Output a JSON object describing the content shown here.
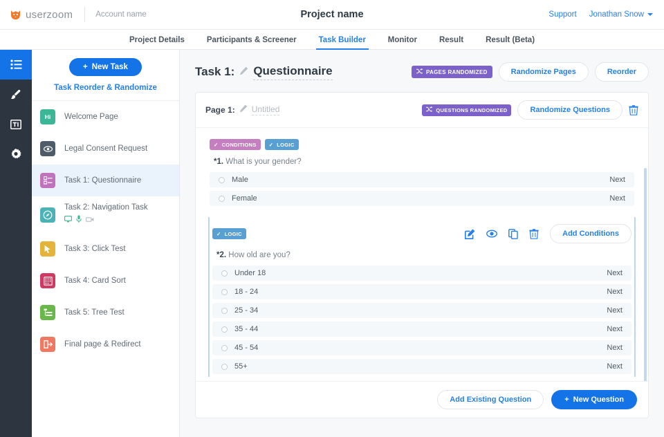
{
  "topbar": {
    "brand": "userzoom",
    "brand_icon": "fox-logo-icon",
    "account_name": "Account name",
    "project_title": "Project name",
    "support_label": "Support",
    "user_name": "Jonathan Snow"
  },
  "nav_tabs": [
    {
      "label": "Project Details",
      "active": false
    },
    {
      "label": "Participants & Screener",
      "active": false
    },
    {
      "label": "Task Builder",
      "active": true
    },
    {
      "label": "Monitor",
      "active": false
    },
    {
      "label": "Result",
      "active": false
    },
    {
      "label": "Result (Beta)",
      "active": false
    }
  ],
  "rail": [
    {
      "icon": "list-icon",
      "active": true
    },
    {
      "icon": "brush-icon",
      "active": false
    },
    {
      "icon": "text-box-icon",
      "active": false
    },
    {
      "icon": "gear-icon",
      "active": false
    }
  ],
  "sidebar": {
    "new_task_label": "New Task",
    "new_task_plus": "+",
    "reorder_link": "Task Reorder & Randomize",
    "items": [
      {
        "label": "Welcome Page",
        "tile_text": "Hi",
        "tile_color": "#3cb795",
        "icon": "hi-tile-icon",
        "selected": false,
        "subicons": []
      },
      {
        "label": "Legal Consent Request",
        "tile_text": "",
        "tile_color": "#4e5b69",
        "icon": "eye-tile-icon",
        "selected": false,
        "subicons": []
      },
      {
        "label": "Task 1: Questionnaire",
        "tile_text": "",
        "tile_color": "#c072bd",
        "icon": "form-tile-icon",
        "selected": true,
        "subicons": []
      },
      {
        "label": "Task 2: Navigation Task",
        "tile_text": "",
        "tile_color": "#4bb3b8",
        "icon": "compass-tile-icon",
        "selected": false,
        "subicons": [
          "monitor-icon",
          "microphone-icon",
          "video-camera-icon"
        ]
      },
      {
        "label": "Task 3: Click Test",
        "tile_text": "",
        "tile_color": "#e3b33a",
        "icon": "cursor-tile-icon",
        "selected": false,
        "subicons": []
      },
      {
        "label": "Task 4: Card Sort",
        "tile_text": "",
        "tile_color": "#cf3a62",
        "icon": "cards-tile-icon",
        "selected": false,
        "subicons": []
      },
      {
        "label": "Task 5: Tree Test",
        "tile_text": "",
        "tile_color": "#6ab84a",
        "icon": "tree-tile-icon",
        "selected": false,
        "subicons": []
      },
      {
        "label": "Final page & Redirect",
        "tile_text": "",
        "tile_color": "#ef7862",
        "icon": "exit-tile-icon",
        "selected": false,
        "subicons": []
      }
    ]
  },
  "task_header": {
    "prefix": "Task 1:",
    "name": "Questionnaire",
    "edit_icon": "pencil-icon",
    "pages_randomized_badge": "PAGES RANDOMIZED",
    "shuffle_icon": "shuffle-icon",
    "randomize_pages_label": "Randomize Pages",
    "reorder_label": "Reorder"
  },
  "page_card": {
    "page_label": "Page 1:",
    "page_name_placeholder": "Untitled",
    "edit_icon": "pencil-icon",
    "questions_randomized_badge": "QUESTIONS RANDOMIZED",
    "shuffle_icon": "shuffle-icon",
    "randomize_questions_label": "Randomize Questions",
    "delete_icon": "trash-icon",
    "footer": {
      "add_existing_label": "Add Existing Question",
      "new_question_label": "New Question",
      "new_question_plus": "+"
    }
  },
  "questions": [
    {
      "number": "*1.",
      "text": "What is your gender?",
      "selected": false,
      "badges": [
        {
          "label": "CONDITIONS",
          "color": "pink",
          "check": "✓"
        },
        {
          "label": "LOGIC",
          "color": "blue",
          "check": "✓"
        }
      ],
      "tools": [],
      "add_conditions_label": "",
      "answers": [
        {
          "label": "Male",
          "next": "Next"
        },
        {
          "label": "Female",
          "next": "Next"
        }
      ]
    },
    {
      "number": "*2.",
      "text": "How old are you?",
      "selected": true,
      "badges": [
        {
          "label": "LOGIC",
          "color": "blue",
          "check": "✓"
        }
      ],
      "tools": [
        "edit-icon",
        "preview-eye-icon",
        "duplicate-icon",
        "trash-icon"
      ],
      "add_conditions_label": "Add Conditions",
      "answers": [
        {
          "label": "Under 18",
          "next": "Next"
        },
        {
          "label": "18 - 24",
          "next": "Next"
        },
        {
          "label": "25 - 34",
          "next": "Next"
        },
        {
          "label": "35 - 44",
          "next": "Next"
        },
        {
          "label": "45 - 54",
          "next": "Next"
        },
        {
          "label": "55+",
          "next": "Next"
        }
      ]
    }
  ],
  "colors": {
    "accent_blue": "#1473e6",
    "link_blue": "#2680eb",
    "rail_dark": "#2d3540",
    "badge_purple": "#7b61c9",
    "badge_pink": "#c57fc0",
    "badge_blue": "#58a0d3",
    "selected_row": "#eaf2fb"
  }
}
